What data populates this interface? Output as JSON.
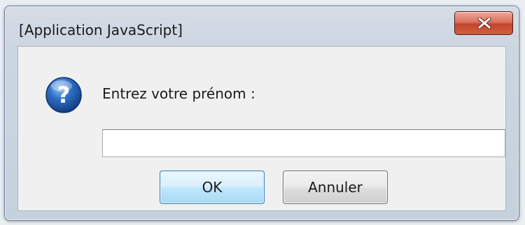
{
  "window": {
    "title": "[Application JavaScript]"
  },
  "titlebar": {
    "close_icon": "close-icon"
  },
  "dialog": {
    "icon": "question-icon",
    "prompt": "Entrez votre prénom :",
    "input_value": "",
    "ok_label": "OK",
    "cancel_label": "Annuler"
  },
  "colors": {
    "close_button": "#c3452c",
    "ok_button_border": "#3c7fb1",
    "question_icon": "#2b64b3"
  }
}
